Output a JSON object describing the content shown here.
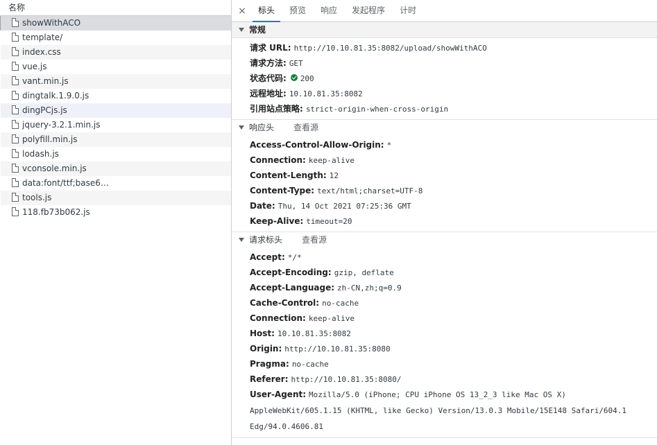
{
  "left_panel": {
    "header": "名称",
    "files": [
      {
        "name": "showWithACO",
        "state": "selected"
      },
      {
        "name": "template/",
        "state": "normal"
      },
      {
        "name": "index.css",
        "state": "alt"
      },
      {
        "name": "vue.js",
        "state": "normal"
      },
      {
        "name": "vant.min.js",
        "state": "alt"
      },
      {
        "name": "dingtalk.1.9.0.js",
        "state": "normal"
      },
      {
        "name": "dingPCjs.js",
        "state": "hover"
      },
      {
        "name": "jquery-3.2.1.min.js",
        "state": "normal"
      },
      {
        "name": "polyfill.min.js",
        "state": "alt"
      },
      {
        "name": "lodash.js",
        "state": "normal"
      },
      {
        "name": "vconsole.min.js",
        "state": "alt"
      },
      {
        "name": "data:font/ttf;base6…",
        "state": "normal"
      },
      {
        "name": "tools.js",
        "state": "alt"
      },
      {
        "name": "118.fb73b062.js",
        "state": "normal"
      }
    ]
  },
  "tabs": {
    "close_icon": "×",
    "items": [
      "标头",
      "预览",
      "响应",
      "发起程序",
      "计时"
    ],
    "active_index": 0
  },
  "general": {
    "title": "常规",
    "rows": [
      {
        "key": "请求 URL:",
        "value": "http://10.10.81.35:8082/upload/showWithACO"
      },
      {
        "key": "请求方法:",
        "value": "GET"
      },
      {
        "key": "状态代码:",
        "value": "200",
        "status_ok": true
      },
      {
        "key": "远程地址:",
        "value": "10.10.81.35:8082"
      },
      {
        "key": "引用站点策略:",
        "value": "strict-origin-when-cross-origin"
      }
    ]
  },
  "response_headers": {
    "title": "响应头",
    "view_source": "查看源",
    "rows": [
      {
        "key": "Access-Control-Allow-Origin:",
        "value": "*"
      },
      {
        "key": "Connection:",
        "value": "keep-alive"
      },
      {
        "key": "Content-Length:",
        "value": "12"
      },
      {
        "key": "Content-Type:",
        "value": "text/html;charset=UTF-8"
      },
      {
        "key": "Date:",
        "value": "Thu, 14 Oct 2021 07:25:36 GMT"
      },
      {
        "key": "Keep-Alive:",
        "value": "timeout=20"
      }
    ]
  },
  "request_headers": {
    "title": "请求标头",
    "view_source": "查看源",
    "rows": [
      {
        "key": "Accept:",
        "value": "*/*"
      },
      {
        "key": "Accept-Encoding:",
        "value": "gzip, deflate"
      },
      {
        "key": "Accept-Language:",
        "value": "zh-CN,zh;q=0.9"
      },
      {
        "key": "Cache-Control:",
        "value": "no-cache"
      },
      {
        "key": "Connection:",
        "value": "keep-alive"
      },
      {
        "key": "Host:",
        "value": "10.10.81.35:8082"
      },
      {
        "key": "Origin:",
        "value": "http://10.10.81.35:8080"
      },
      {
        "key": "Pragma:",
        "value": "no-cache"
      },
      {
        "key": "Referer:",
        "value": "http://10.10.81.35:8080/"
      },
      {
        "key": "User-Agent:",
        "value": "Mozilla/5.0 (iPhone; CPU iPhone OS 13_2_3 like Mac OS X) AppleWebKit/605.1.15 (KHTML, like Gecko) Version/13.0.3 Mobile/15E148 Safari/604.1 Edg/94.0.4606.81"
      }
    ]
  },
  "colors": {
    "accent": "#1a73e8",
    "status_ok": "#188038",
    "selected_row": "#dadce0"
  }
}
